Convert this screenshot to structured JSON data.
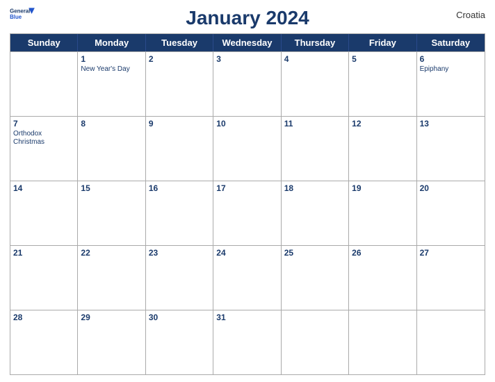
{
  "header": {
    "logo_line1": "General",
    "logo_line2": "Blue",
    "title": "January 2024",
    "country": "Croatia"
  },
  "days_of_week": [
    "Sunday",
    "Monday",
    "Tuesday",
    "Wednesday",
    "Thursday",
    "Friday",
    "Saturday"
  ],
  "weeks": [
    [
      {
        "num": "",
        "event": ""
      },
      {
        "num": "1",
        "event": "New Year's Day"
      },
      {
        "num": "2",
        "event": ""
      },
      {
        "num": "3",
        "event": ""
      },
      {
        "num": "4",
        "event": ""
      },
      {
        "num": "5",
        "event": ""
      },
      {
        "num": "6",
        "event": "Epiphany"
      }
    ],
    [
      {
        "num": "7",
        "event": "Orthodox Christmas"
      },
      {
        "num": "8",
        "event": ""
      },
      {
        "num": "9",
        "event": ""
      },
      {
        "num": "10",
        "event": ""
      },
      {
        "num": "11",
        "event": ""
      },
      {
        "num": "12",
        "event": ""
      },
      {
        "num": "13",
        "event": ""
      }
    ],
    [
      {
        "num": "14",
        "event": ""
      },
      {
        "num": "15",
        "event": ""
      },
      {
        "num": "16",
        "event": ""
      },
      {
        "num": "17",
        "event": ""
      },
      {
        "num": "18",
        "event": ""
      },
      {
        "num": "19",
        "event": ""
      },
      {
        "num": "20",
        "event": ""
      }
    ],
    [
      {
        "num": "21",
        "event": ""
      },
      {
        "num": "22",
        "event": ""
      },
      {
        "num": "23",
        "event": ""
      },
      {
        "num": "24",
        "event": ""
      },
      {
        "num": "25",
        "event": ""
      },
      {
        "num": "26",
        "event": ""
      },
      {
        "num": "27",
        "event": ""
      }
    ],
    [
      {
        "num": "28",
        "event": ""
      },
      {
        "num": "29",
        "event": ""
      },
      {
        "num": "30",
        "event": ""
      },
      {
        "num": "31",
        "event": ""
      },
      {
        "num": "",
        "event": ""
      },
      {
        "num": "",
        "event": ""
      },
      {
        "num": "",
        "event": ""
      }
    ]
  ],
  "colors": {
    "header_bg": "#1a3a6b",
    "header_text": "#ffffff",
    "title_color": "#1a3a6b",
    "cell_border": "#aaaaaa"
  }
}
